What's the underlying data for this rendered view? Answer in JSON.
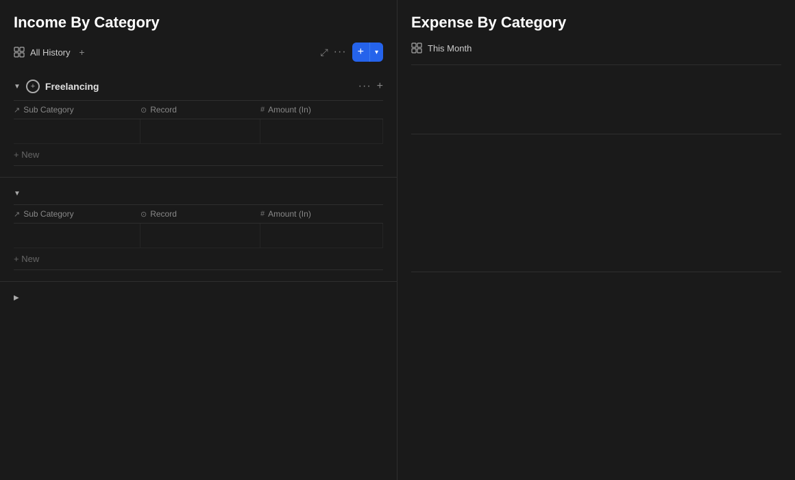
{
  "left_panel": {
    "title": "Income By Category",
    "toolbar": {
      "view_label": "All History",
      "add_plus": "+",
      "resize_icon": "⤢",
      "dots": "···",
      "btn_plus": "+",
      "btn_chevron": "▾"
    },
    "sections": [
      {
        "id": "freelancing",
        "chevron": "▼",
        "name": "Freelancing",
        "columns": [
          {
            "icon": "↗",
            "label": "Sub Category"
          },
          {
            "icon": "⊙",
            "label": "Record"
          },
          {
            "icon": "#",
            "label": "Amount (In)"
          }
        ],
        "rows": [
          {
            "sub_category": "",
            "record": "",
            "amount": ""
          }
        ],
        "new_label": "+ New"
      },
      {
        "id": "section2",
        "chevron": "▼",
        "name": "",
        "columns": [
          {
            "icon": "↗",
            "label": "Sub Category"
          },
          {
            "icon": "⊙",
            "label": "Record"
          },
          {
            "icon": "#",
            "label": "Amount (In)"
          }
        ],
        "rows": [
          {
            "sub_category": "",
            "record": "",
            "amount": ""
          }
        ],
        "new_label": "+ New"
      }
    ],
    "collapsed_section": {
      "chevron": "▶"
    }
  },
  "right_panel": {
    "title": "Expense By Category",
    "toolbar": {
      "view_label": "This Month"
    }
  }
}
